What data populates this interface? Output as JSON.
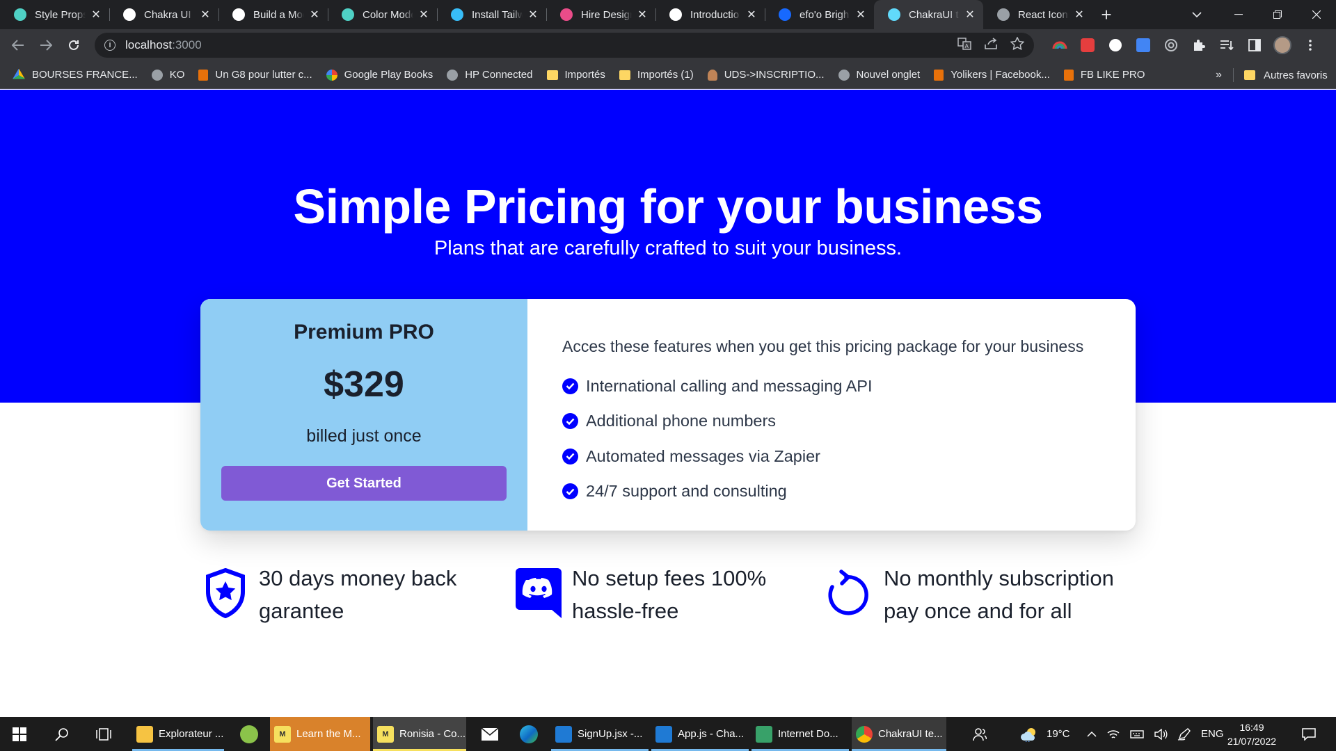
{
  "browser": {
    "tabs": [
      {
        "title": "Style Props",
        "favicon_color": "#4fd1c5",
        "active": false
      },
      {
        "title": "Chakra UI F",
        "favicon_color": "#ffffff",
        "active": false
      },
      {
        "title": "Build a Moc",
        "favicon_color": "#ffffff",
        "active": false
      },
      {
        "title": "Color Mode",
        "favicon_color": "#4fd1c5",
        "active": false
      },
      {
        "title": "Install Tailw",
        "favicon_color": "#38bdf8",
        "active": false
      },
      {
        "title": "Hire Design",
        "favicon_color": "#ea4c89",
        "active": false
      },
      {
        "title": "Introductio",
        "favicon_color": "#ffffff",
        "active": false
      },
      {
        "title": "efo'o Brigh",
        "favicon_color": "#1769ff",
        "active": false
      },
      {
        "title": "ChakraUI te",
        "favicon_color": "#61dafb",
        "active": true
      },
      {
        "title": "React Icons",
        "favicon_color": "#9aa0a6",
        "active": false
      }
    ],
    "tab_close_glyph": "✕",
    "new_tab_glyph": "+",
    "url_host": "localhost",
    "url_port": ":3000",
    "bookmarks": [
      {
        "label": "BOURSES FRANCE...",
        "icon": "drive-icon"
      },
      {
        "label": "KO",
        "icon": "globe-icon"
      },
      {
        "label": "Un G8 pour lutter c...",
        "icon": "page-icon"
      },
      {
        "label": "Google Play Books",
        "icon": "google-icon"
      },
      {
        "label": "HP Connected",
        "icon": "globe-icon"
      },
      {
        "label": "Importés",
        "icon": "folder-icon"
      },
      {
        "label": "Importés (1)",
        "icon": "folder-icon"
      },
      {
        "label": "UDS->INSCRIPTIO...",
        "icon": "person-icon"
      },
      {
        "label": "Nouvel onglet",
        "icon": "globe-icon"
      },
      {
        "label": "Yolikers | Facebook...",
        "icon": "page-icon"
      },
      {
        "label": "FB LIKE PRO",
        "icon": "page-icon"
      }
    ],
    "bookmarks_more": "»",
    "other_bookmarks": "Autres favoris"
  },
  "hero": {
    "title": "Simple Pricing for your business",
    "subtitle": "Plans that are carefully crafted to suit your business."
  },
  "plan": {
    "name": "Premium PRO",
    "price": "$329",
    "billing": "billed just once",
    "cta": "Get Started",
    "features_intro": "Acces these features when you get this pricing package for your business",
    "features": [
      "International calling and messaging API",
      "Additional phone numbers",
      "Automated messages via Zapier",
      "24/7 support and consulting"
    ]
  },
  "perks": [
    {
      "line1": "30 days money back",
      "line2": "garantee",
      "icon": "shield-star-icon"
    },
    {
      "line1": "No setup fees 100%",
      "line2": "hassle-free",
      "icon": "discord-icon"
    },
    {
      "line1": "No monthly subscription",
      "line2": "pay once and for all",
      "icon": "reload-icon"
    }
  ],
  "colors": {
    "hero_bg": "#0000ff",
    "plan_bg": "#90cdf4",
    "cta_bg": "#805ad5",
    "accent": "#0000ff"
  },
  "taskbar": {
    "apps": [
      {
        "label": "Explorateur ..."
      },
      {
        "label": "Learn the M..."
      },
      {
        "label": "Ronisia - Co..."
      },
      {
        "label": "SignUp.jsx -..."
      },
      {
        "label": "App.js - Cha..."
      },
      {
        "label": "Internet Do..."
      },
      {
        "label": "ChakraUI te..."
      }
    ],
    "weather": "19°C",
    "language": "ENG",
    "time": "16:49",
    "date": "21/07/2022"
  }
}
